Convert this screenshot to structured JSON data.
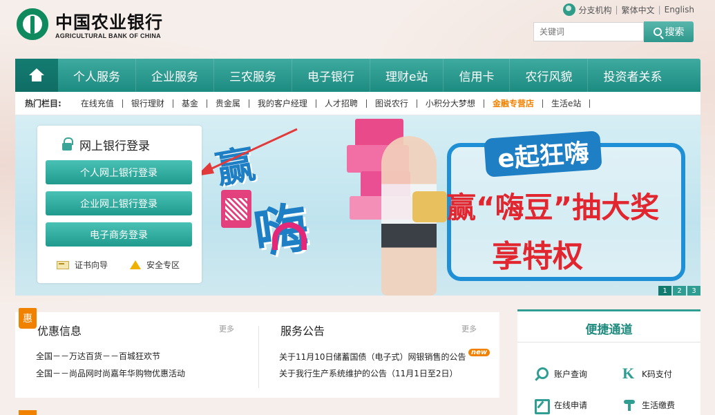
{
  "header": {
    "logo_cn": "中国农业银行",
    "logo_en": "AGRICULTURAL BANK OF CHINA",
    "top_links": [
      "分支机构",
      "繁体中文",
      "English"
    ],
    "search_placeholder": "关键词",
    "search_button": "搜索"
  },
  "nav": {
    "items": [
      "个人服务",
      "企业服务",
      "三农服务",
      "电子银行",
      "理财e站",
      "信用卡",
      "农行风貌",
      "投资者关系"
    ]
  },
  "hotbar": {
    "label": "热门栏目:",
    "items": [
      "在线充值",
      "银行理财",
      "基金",
      "贵金属",
      "我的客户经理",
      "人才招聘",
      "图说农行",
      "小积分大梦想",
      "金融专营店",
      "生活e站"
    ]
  },
  "login": {
    "title": "网上银行登录",
    "buttons": [
      "个人网上银行登录",
      "企业网上银行登录",
      "电子商务登录"
    ],
    "links": [
      "证书向导",
      "安全专区"
    ]
  },
  "banner": {
    "text_win": "赢",
    "text_hai": "嗨",
    "tag": "e起狂嗨",
    "line1": "赢“嗨豆”抽大奖",
    "line2": "享特权",
    "slides": [
      "1",
      "2",
      "3"
    ],
    "active_slide": 1
  },
  "promotions": {
    "badge": "惠",
    "title": "优惠信息",
    "more": "更多",
    "items": [
      "全国－－万达百货－－百城狂欢节",
      "全国－－尚品网时尚嘉年华购物优惠活动"
    ]
  },
  "notices": {
    "title": "服务公告",
    "more": "更多",
    "items": [
      "关于11月10日储蓄国债（电子式）网银销售的公告",
      "关于我行生产系统维护的公告（11月1日至2日）"
    ],
    "new_badge": "new"
  },
  "quick": {
    "title": "便捷通道",
    "items": [
      "账户查询",
      "K码支付",
      "在线申请",
      "生活缴费"
    ]
  }
}
